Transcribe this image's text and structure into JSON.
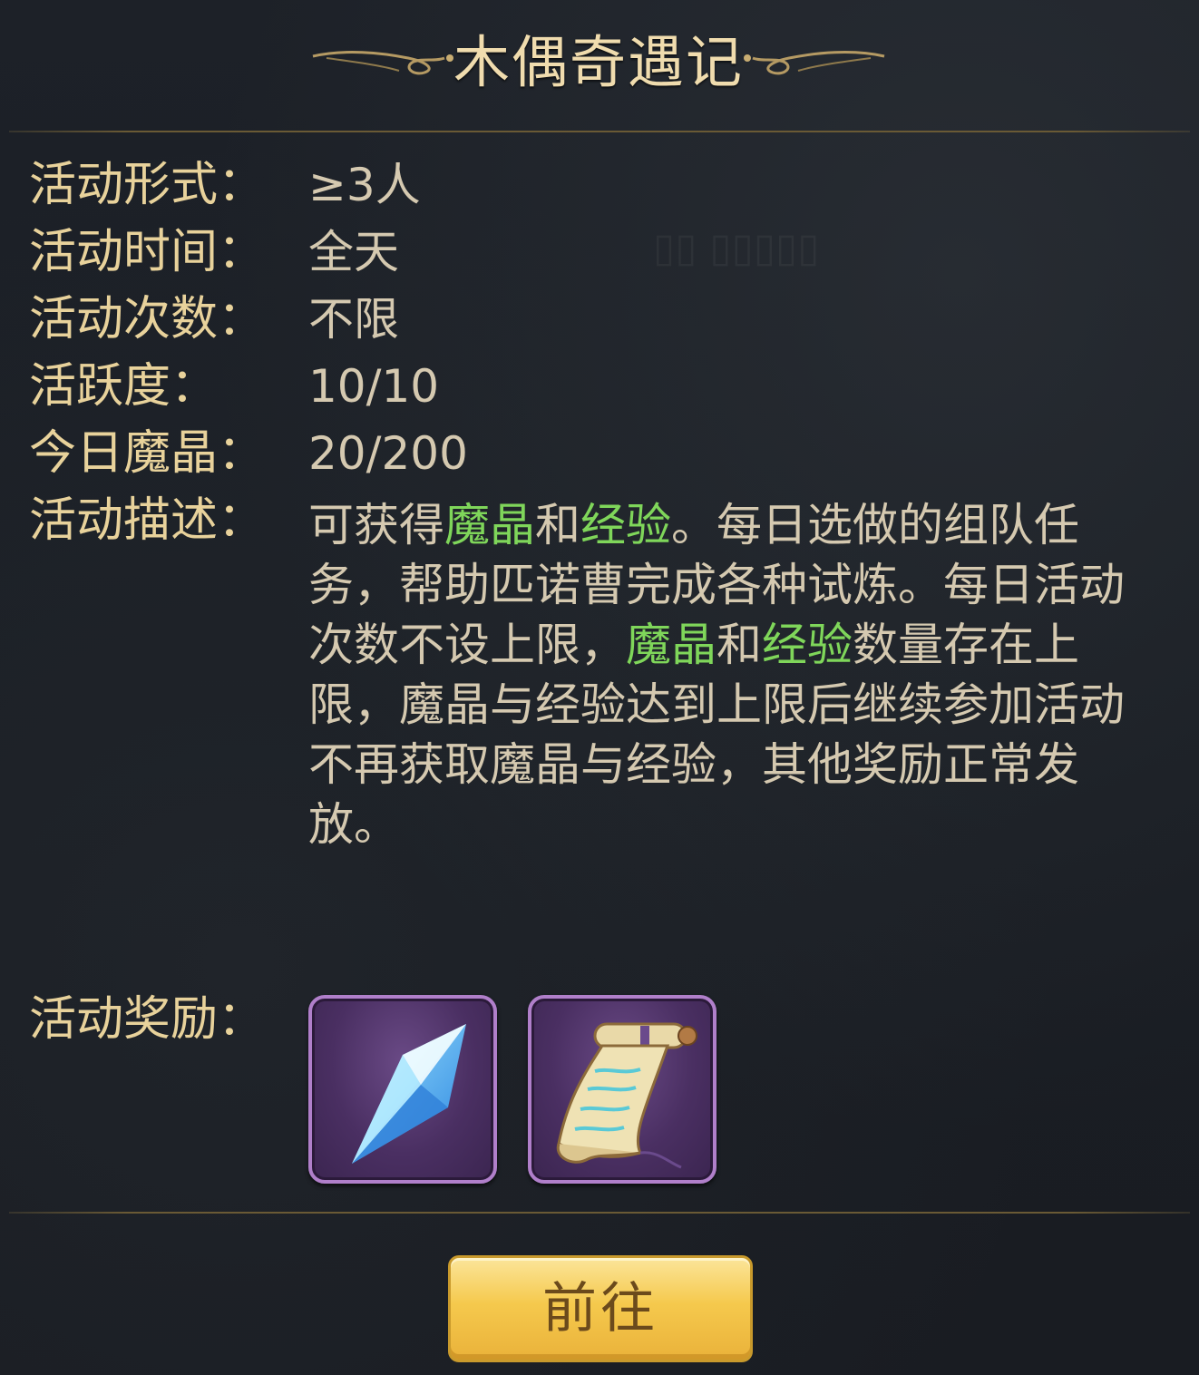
{
  "title": "木偶奇遇记",
  "rows": {
    "form": {
      "label": "活动形式：",
      "value": "≥3人"
    },
    "time": {
      "label": "活动时间：",
      "value": "全天"
    },
    "count": {
      "label": "活动次数：",
      "value": "不限"
    },
    "activity": {
      "label": "活跃度：",
      "value": "10/10"
    },
    "crystal_today": {
      "label": "今日魔晶：",
      "value": "20/200"
    }
  },
  "description": {
    "label": "活动描述：",
    "segments": [
      {
        "text": "可获得",
        "highlight": false
      },
      {
        "text": "魔晶",
        "highlight": true
      },
      {
        "text": "和",
        "highlight": false
      },
      {
        "text": "经验",
        "highlight": true
      },
      {
        "text": "。每日选做的组队任务，帮助匹诺曹完成各种试炼。每日活动次数不设上限，",
        "highlight": false
      },
      {
        "text": "魔晶",
        "highlight": true
      },
      {
        "text": "和",
        "highlight": false
      },
      {
        "text": "经验",
        "highlight": true
      },
      {
        "text": "数量存在上限，魔晶与经验达到上限后继续参加活动不再获取魔晶与经验，其他奖励正常发放。",
        "highlight": false
      }
    ]
  },
  "rewards": {
    "label": "活动奖励：",
    "items": [
      {
        "icon": "blue-crystal-icon"
      },
      {
        "icon": "scroll-icon"
      }
    ]
  },
  "go_button": {
    "label": "前往"
  },
  "colors": {
    "label": "#e8d29b",
    "value": "#d5c9b0",
    "highlight": "#7fd65a",
    "button": "#f5c94d"
  }
}
